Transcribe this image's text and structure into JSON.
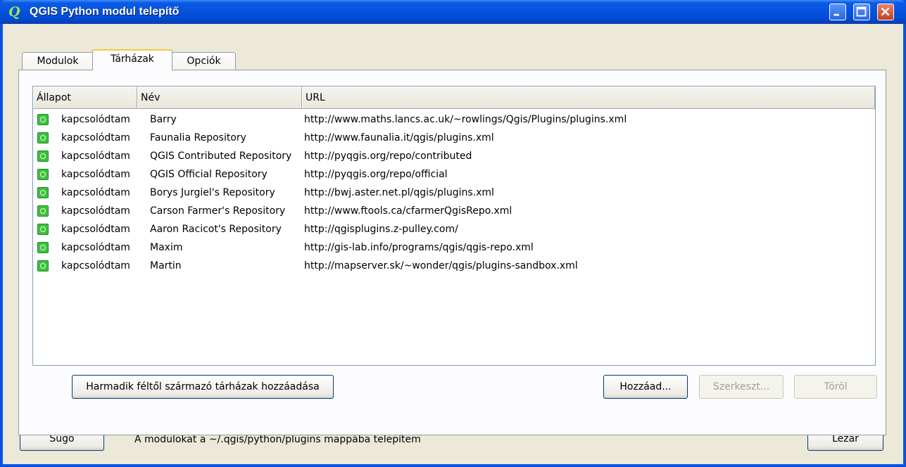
{
  "window": {
    "title": "QGIS Python modul telepítő",
    "app_icon_glyph": "Q"
  },
  "tabs": [
    {
      "label": "Modulok",
      "active": false
    },
    {
      "label": "Tárházak",
      "active": true
    },
    {
      "label": "Opciók",
      "active": false
    }
  ],
  "table": {
    "columns": [
      "Állapot",
      "Név",
      "URL"
    ],
    "rows": [
      {
        "status": "kapcsolódtam",
        "name": "Barry",
        "url": "http://www.maths.lancs.ac.uk/~rowlings/Qgis/Plugins/plugins.xml"
      },
      {
        "status": "kapcsolódtam",
        "name": "Faunalia Repository",
        "url": "http://www.faunalia.it/qgis/plugins.xml"
      },
      {
        "status": "kapcsolódtam",
        "name": "QGIS Contributed Repository",
        "url": "http://pyqgis.org/repo/contributed"
      },
      {
        "status": "kapcsolódtam",
        "name": "QGIS Official Repository",
        "url": "http://pyqgis.org/repo/official"
      },
      {
        "status": "kapcsolódtam",
        "name": "Borys Jurgiel's Repository",
        "url": "http://bwj.aster.net.pl/qgis/plugins.xml"
      },
      {
        "status": "kapcsolódtam",
        "name": "Carson Farmer's Repository",
        "url": "http://www.ftools.ca/cfarmerQgisRepo.xml"
      },
      {
        "status": "kapcsolódtam",
        "name": "Aaron Racicot's Repository",
        "url": "http://qgisplugins.z-pulley.com/"
      },
      {
        "status": "kapcsolódtam",
        "name": "Maxim",
        "url": "http://gis-lab.info/programs/qgis/qgis-repo.xml"
      },
      {
        "status": "kapcsolódtam",
        "name": "Martin",
        "url": "http://mapserver.sk/~wonder/qgis/plugins-sandbox.xml"
      }
    ]
  },
  "buttons": {
    "third_party": "Harmadik féltől származó tárházak hozzáadása",
    "add": "Hozzáad...",
    "edit": "Szerkeszt...",
    "delete": "Töröl",
    "help": "Súgó",
    "close": "Lezár"
  },
  "footer": {
    "status": "A modulokat a ~/.qgis/python/plugins mappába telepítem"
  },
  "colors": {
    "titlebar": "#0752dc",
    "status_connected": "#3fbf3f",
    "active_tab_accent": "#ffc83c"
  }
}
